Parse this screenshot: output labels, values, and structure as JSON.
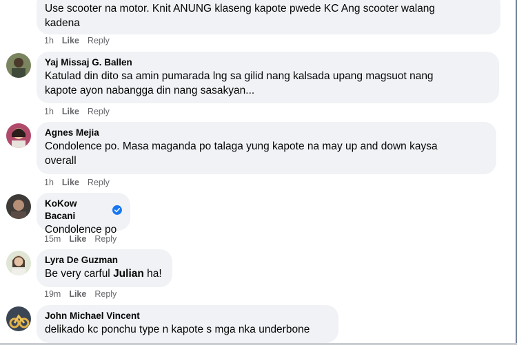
{
  "comments": [
    {
      "author": "",
      "text_line1": "Use scooter na motor. Knit ANUNG klaseng kapote pwede KC Ang scooter walang",
      "text_line2": "kadena",
      "time": "1h",
      "like": "Like",
      "reply": "Reply"
    },
    {
      "author": "Yaj Missaj G. Ballen",
      "text_line1": "Katulad din dito sa amin pumarada lng sa gilid nang kalsada upang magsuot nang",
      "text_line2": "kapote ayon nabangga din nang sasakyan...",
      "time": "1h",
      "like": "Like",
      "reply": "Reply"
    },
    {
      "author": "Agnes Mejia",
      "text_line1": "Condolence po. Masa maganda po talaga yung kapote na may up and down kaysa",
      "text_line2": "overall",
      "time": "1h",
      "like": "Like",
      "reply": "Reply"
    },
    {
      "author": "KoKow Bacani",
      "verified": true,
      "text_line1": "Condolence po",
      "time": "15m",
      "like": "Like",
      "reply": "Reply"
    },
    {
      "author": "Lyra De Guzman",
      "text_pre": "Be very carful ",
      "text_bold": "Julian",
      "text_post": " ha!",
      "time": "19m",
      "like": "Like",
      "reply": "Reply"
    },
    {
      "author": "John Michael Vincent",
      "text_line1": "delikado kc ponchu type n kapote s mga nka underbone"
    }
  ],
  "colors": {
    "bubble": "#f0f2f5",
    "meta": "#65676b",
    "verified": "#1877f2"
  }
}
